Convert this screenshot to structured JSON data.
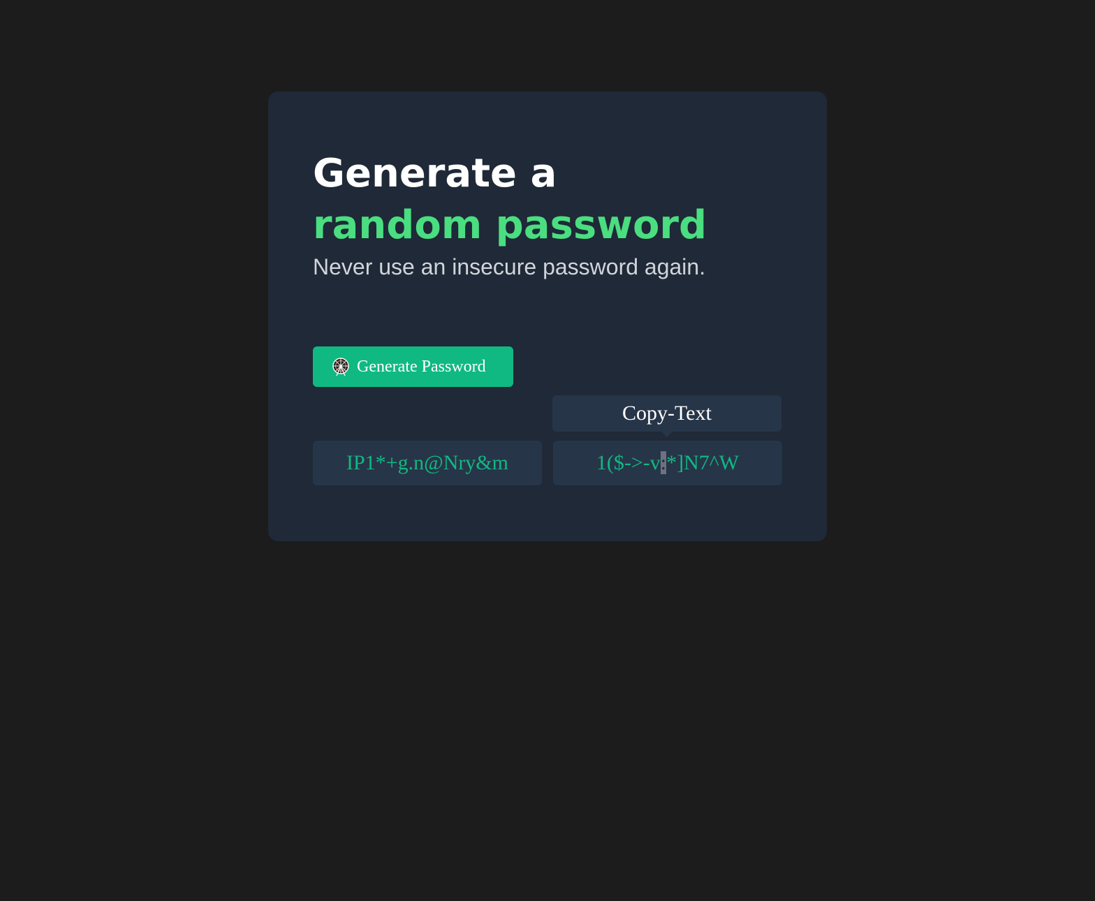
{
  "heading": {
    "line1": "Generate a",
    "line2": "random password"
  },
  "subtitle": "Never use an insecure password again.",
  "generate_button": {
    "label": "Generate Password",
    "icon": "ferris-wheel-icon"
  },
  "tooltip": {
    "label": "Copy-Text"
  },
  "passwords": {
    "first": "IP1*+g.n@Nry&m",
    "second_before": "1($->-v",
    "second_highlight": ":",
    "second_after": "*]N7^W"
  },
  "colors": {
    "page_background": "#1c1c1c",
    "card_background": "#1f2937",
    "accent_green": "#4ade80",
    "button_green": "#10b981",
    "field_background": "#273549"
  }
}
